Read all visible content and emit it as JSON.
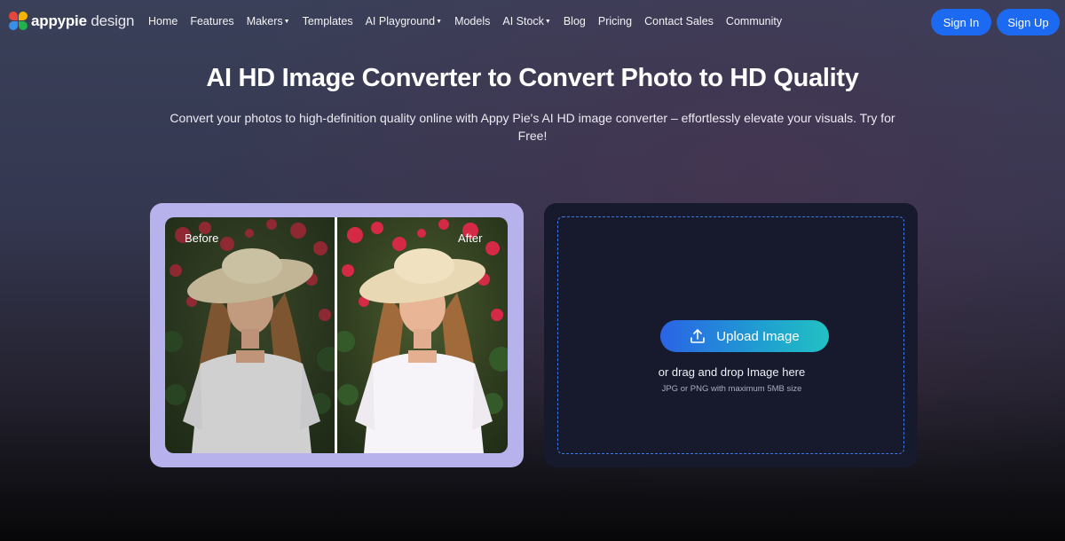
{
  "brand": {
    "name_bold": "appypie",
    "name_light": " design"
  },
  "nav": {
    "items": [
      {
        "label": "Home",
        "dropdown": false
      },
      {
        "label": "Features",
        "dropdown": false
      },
      {
        "label": "Makers",
        "dropdown": true
      },
      {
        "label": "Templates",
        "dropdown": false
      },
      {
        "label": "AI Playground",
        "dropdown": true
      },
      {
        "label": "Models",
        "dropdown": false
      },
      {
        "label": "AI Stock",
        "dropdown": true
      },
      {
        "label": "Blog",
        "dropdown": false
      },
      {
        "label": "Pricing",
        "dropdown": false
      },
      {
        "label": "Contact Sales",
        "dropdown": false
      },
      {
        "label": "Community",
        "dropdown": false
      }
    ],
    "signin": "Sign In",
    "signup": "Sign Up"
  },
  "hero": {
    "title": "AI HD Image Converter to Convert Photo to HD Quality",
    "subtitle": "Convert your photos to high-definition quality online with Appy Pie's AI HD image converter – effortlessly elevate your visuals. Try for Free!"
  },
  "compare": {
    "before_label": "Before",
    "after_label": "After"
  },
  "upload": {
    "button": "Upload Image",
    "drag_text": "or drag and drop Image here",
    "hint": "JPG or PNG with maximum 5MB size"
  },
  "colors": {
    "accent": "#1c6af2",
    "card": "#b7b2ec",
    "panel": "#161a2c",
    "dashed": "#3b79e6"
  }
}
